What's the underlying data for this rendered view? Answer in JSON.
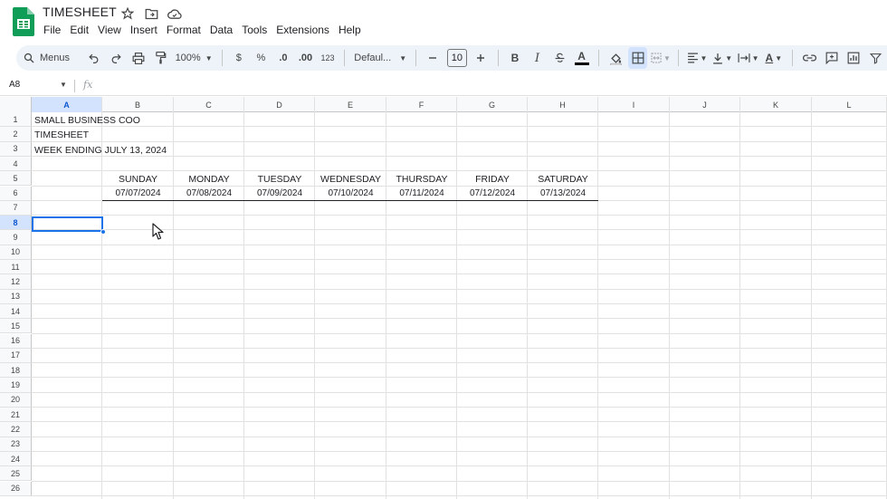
{
  "app": {
    "doc_title": "TIMESHEET",
    "menu": [
      "File",
      "Edit",
      "View",
      "Insert",
      "Format",
      "Data",
      "Tools",
      "Extensions",
      "Help"
    ]
  },
  "toolbar": {
    "search_label": "Menus",
    "zoom": "100%",
    "currency": "$",
    "percent": "%",
    "dec_decrease": ".0",
    "dec_increase": ".00",
    "number_format": "123",
    "font": "Defaul...",
    "font_size": "10",
    "bold": "B",
    "italic": "I",
    "text_color": "A",
    "text_rotate": "A"
  },
  "formula_bar": {
    "name_box": "A8",
    "fx": "fx"
  },
  "columns": [
    "A",
    "B",
    "C",
    "D",
    "E",
    "F",
    "G",
    "H",
    "I",
    "J",
    "K",
    "L"
  ],
  "selected_column": "A",
  "rows": [
    "1",
    "2",
    "3",
    "4",
    "5",
    "6",
    "7",
    "8",
    "9",
    "10",
    "11",
    "12",
    "13",
    "14",
    "15",
    "16",
    "17",
    "18",
    "19",
    "20",
    "21",
    "22",
    "23",
    "24",
    "25",
    "26"
  ],
  "selected_row": "8",
  "sheet": {
    "a1": "SMALL BUSINESS COO",
    "a2": "TIMESHEET",
    "a3": "WEEK ENDING JULY 13, 2024",
    "days": [
      "SUNDAY",
      "MONDAY",
      "TUESDAY",
      "WEDNESDAY",
      "THURSDAY",
      "FRIDAY",
      "SATURDAY"
    ],
    "dates": [
      "07/07/2024",
      "07/08/2024",
      "07/09/2024",
      "07/10/2024",
      "07/11/2024",
      "07/12/2024",
      "07/13/2024"
    ]
  },
  "colors": {
    "accent": "#1a73e8",
    "toolbar_bg": "#eef2f9",
    "logo_green": "#0f9d58"
  }
}
